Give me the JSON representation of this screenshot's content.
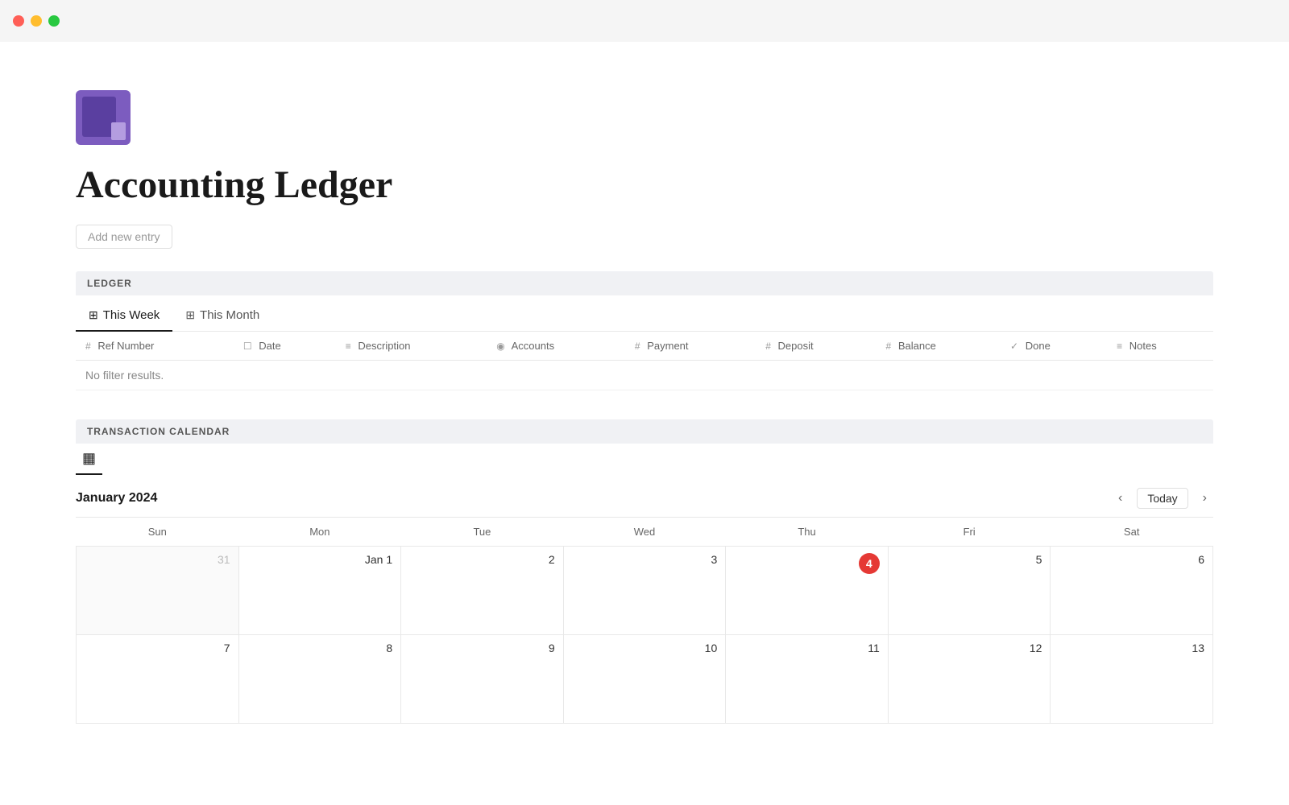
{
  "titlebar": {
    "buttons": [
      "close",
      "minimize",
      "maximize"
    ]
  },
  "page": {
    "title": "Accounting Ledger",
    "add_entry_placeholder": "Add new entry"
  },
  "ledger_section": {
    "label": "LEDGER",
    "tabs": [
      {
        "id": "this-week",
        "label": "This Week",
        "active": true
      },
      {
        "id": "this-month",
        "label": "This Month",
        "active": false
      }
    ],
    "columns": [
      {
        "icon": "#",
        "label": "Ref Number"
      },
      {
        "icon": "☐",
        "label": "Date"
      },
      {
        "icon": "≡",
        "label": "Description"
      },
      {
        "icon": "◉",
        "label": "Accounts"
      },
      {
        "icon": "#",
        "label": "Payment"
      },
      {
        "icon": "#",
        "label": "Deposit"
      },
      {
        "icon": "#",
        "label": "Balance"
      },
      {
        "icon": "✓",
        "label": "Done"
      },
      {
        "icon": "≡",
        "label": "Notes"
      }
    ],
    "no_results_text": "No filter results."
  },
  "calendar_section": {
    "label": "TRANSACTION CALENDAR",
    "month_title": "January 2024",
    "today_label": "Today",
    "days_of_week": [
      "Sun",
      "Mon",
      "Tue",
      "Wed",
      "Thu",
      "Fri",
      "Sat"
    ],
    "weeks": [
      [
        {
          "num": "31",
          "label": "",
          "prev_month": true
        },
        {
          "num": "Jan 1",
          "label": "",
          "is_jan1": true
        },
        {
          "num": "2",
          "label": ""
        },
        {
          "num": "3",
          "label": ""
        },
        {
          "num": "4",
          "label": "",
          "today": true
        },
        {
          "num": "5",
          "label": ""
        },
        {
          "num": "6",
          "label": ""
        }
      ],
      [
        {
          "num": "7",
          "label": ""
        },
        {
          "num": "8",
          "label": ""
        },
        {
          "num": "9",
          "label": ""
        },
        {
          "num": "10",
          "label": ""
        },
        {
          "num": "11",
          "label": ""
        },
        {
          "num": "12",
          "label": ""
        },
        {
          "num": "13",
          "label": ""
        }
      ]
    ]
  }
}
